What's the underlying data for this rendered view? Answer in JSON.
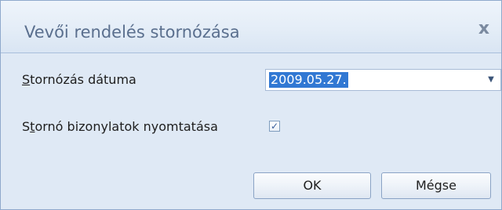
{
  "dialog": {
    "title": "Vevői rendelés stornózása",
    "close_symbol": "x"
  },
  "fields": {
    "storno_date": {
      "label_hotkey": "S",
      "label_rest": "tornózás dátuma",
      "value": "2009.05.27."
    },
    "print_documents": {
      "label_prefix": "S",
      "label_hotkey": "t",
      "label_rest": "ornó bizonylatok nyomtatása",
      "checked": true,
      "check_mark": "✓"
    }
  },
  "buttons": {
    "ok_label": "OK",
    "cancel_label": "Mégse"
  },
  "icons": {
    "dropdown": "chevron-down-icon",
    "close": "close-icon",
    "checkbox": "check-icon"
  },
  "colors": {
    "dialog_bg": "#dfe9f5",
    "title_text": "#5a6f8e",
    "selection": "#3178d3",
    "border": "#8fa9cc"
  }
}
